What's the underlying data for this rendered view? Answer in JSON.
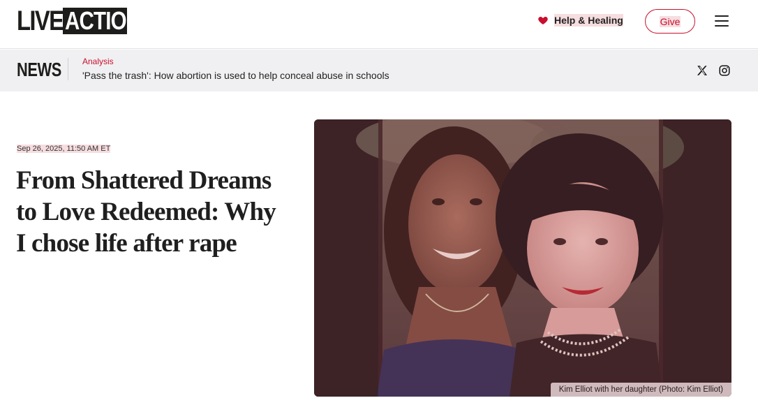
{
  "header": {
    "logo_live": "LIVE",
    "logo_action": "ACTION",
    "help_label": "Help & Healing",
    "give_label": "Give"
  },
  "newsbar": {
    "section_label": "NEWS",
    "category": "Analysis",
    "headline": "'Pass the trash': How abortion is used to help conceal abuse in schools"
  },
  "article": {
    "date": "Sep 26, 2025, 11:50 AM ET",
    "title": "From Shattered Dreams to Love Redeemed: Why I chose life after rape",
    "photo_caption": "Kim Elliot with her daughter (Photo: Kim Elliot)"
  },
  "icons": {
    "heart": "heart-icon",
    "menu": "hamburger-menu-icon",
    "x": "x-social-icon",
    "instagram": "instagram-icon"
  },
  "colors": {
    "brand_red": "#c8102e",
    "highlight_pink": "#f6dde0",
    "newsbar_bg": "#f0f0f2",
    "photo_tint": "#3d2226"
  }
}
